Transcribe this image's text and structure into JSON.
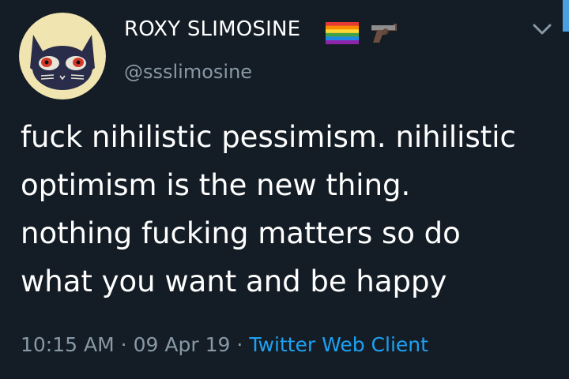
{
  "tweet": {
    "author": {
      "display_name": "ROXY SLIMOSINE",
      "handle": "@ssslimosine",
      "name_emojis": [
        "rainbow-flag-icon",
        "pistol-icon"
      ]
    },
    "text": "fuck nihilistic pessimism. nihilistic\noptimism is the new thing.\nnothing fucking matters so do\nwhat you want and be happy",
    "meta": {
      "time": "10:15 AM",
      "separator": "·",
      "date": "09 Apr 19",
      "client": "Twitter Web Client"
    }
  },
  "colors": {
    "background": "#141d26",
    "text": "#ffffff",
    "secondary": "#8899a6",
    "link": "#1da1f2"
  }
}
